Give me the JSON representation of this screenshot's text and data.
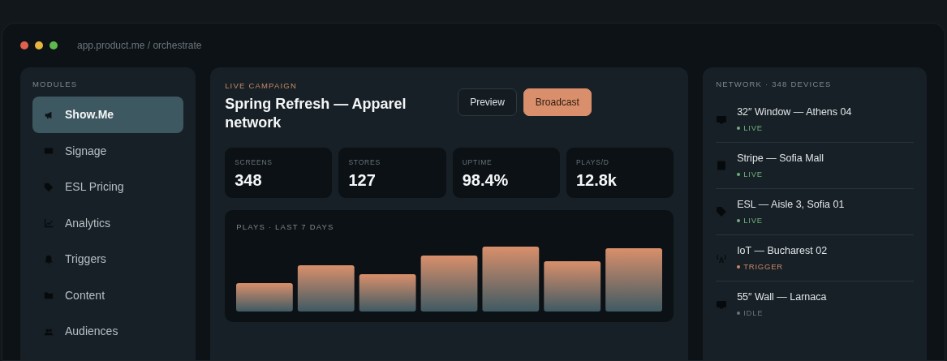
{
  "window": {
    "address": "app.product.me / orchestrate"
  },
  "sidebar": {
    "heading": "MODULES",
    "items": [
      {
        "label": "Show.Me",
        "selected": true
      },
      {
        "label": "Signage",
        "selected": false
      },
      {
        "label": "ESL Pricing",
        "selected": false
      },
      {
        "label": "Analytics",
        "selected": false
      },
      {
        "label": "Triggers",
        "selected": false
      },
      {
        "label": "Content",
        "selected": false
      },
      {
        "label": "Audiences",
        "selected": false
      }
    ]
  },
  "campaign": {
    "eyebrow": "LIVE CAMPAIGN",
    "title": "Spring Refresh — Apparel network",
    "buttons": [
      {
        "label": "Preview",
        "kind": "outline"
      },
      {
        "label": "Broadcast",
        "kind": "primary"
      }
    ],
    "stats": [
      {
        "label": "SCREENS",
        "value": "348"
      },
      {
        "label": "STORES",
        "value": "127"
      },
      {
        "label": "UPTIME",
        "value": "98.4%"
      },
      {
        "label": "PLAYS/D",
        "value": "12.8k"
      }
    ],
    "chart": {
      "title": "PLAYS · LAST 7 DAYS"
    }
  },
  "network": {
    "heading": "NETWORK · 348 DEVICES",
    "devices": [
      {
        "name": "32″ Window — Athens 04",
        "kind": "display",
        "status": "LIVE",
        "color": "#6fae7c"
      },
      {
        "name": "Stripe — Sofia Mall",
        "kind": "tablet",
        "status": "LIVE",
        "color": "#6fae7c"
      },
      {
        "name": "ESL — Aisle 3, Sofia 01",
        "kind": "tag",
        "status": "LIVE",
        "color": "#6fae7c"
      },
      {
        "name": "IoT — Bucharest 02",
        "kind": "antenna",
        "status": "TRIGGER",
        "color": "#c98a66"
      },
      {
        "name": "55″ Wall — Larnaca",
        "kind": "display",
        "status": "IDLE",
        "color": "#6b7378"
      }
    ]
  }
}
